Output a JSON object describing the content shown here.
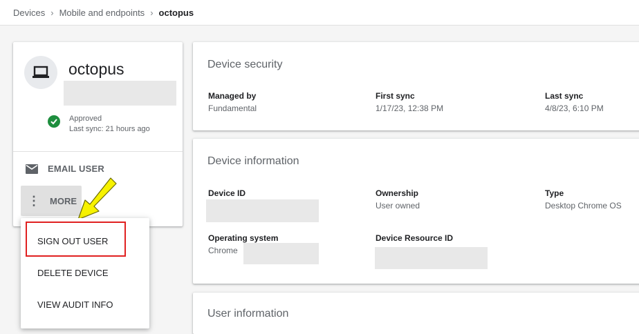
{
  "breadcrumb": {
    "items": [
      "Devices",
      "Mobile and endpoints"
    ],
    "current": "octopus",
    "separator": "›"
  },
  "device": {
    "name": "octopus",
    "status": "Approved",
    "last_sync": "Last sync: 21 hours ago"
  },
  "actions": {
    "email_user": "EMAIL USER",
    "more": "MORE"
  },
  "menu": {
    "items": [
      "SIGN OUT USER",
      "DELETE DEVICE",
      "VIEW AUDIT INFO"
    ]
  },
  "security": {
    "title": "Device security",
    "fields": [
      {
        "label": "Managed by",
        "value": "Fundamental"
      },
      {
        "label": "First sync",
        "value": "1/17/23, 12:38 PM"
      },
      {
        "label": "Last sync",
        "value": "4/8/23, 6:10 PM"
      }
    ]
  },
  "info": {
    "title": "Device information",
    "fields": [
      {
        "label": "Device ID",
        "value": ""
      },
      {
        "label": "Ownership",
        "value": "User owned"
      },
      {
        "label": "Type",
        "value": "Desktop Chrome OS"
      },
      {
        "label": "Operating system",
        "value": "Chrome"
      },
      {
        "label": "Device Resource ID",
        "value": ""
      }
    ]
  },
  "user_info": {
    "title": "User information"
  },
  "colors": {
    "approved": "#1e8e3e",
    "highlight": "#e02020",
    "arrow": "#f7f200"
  }
}
